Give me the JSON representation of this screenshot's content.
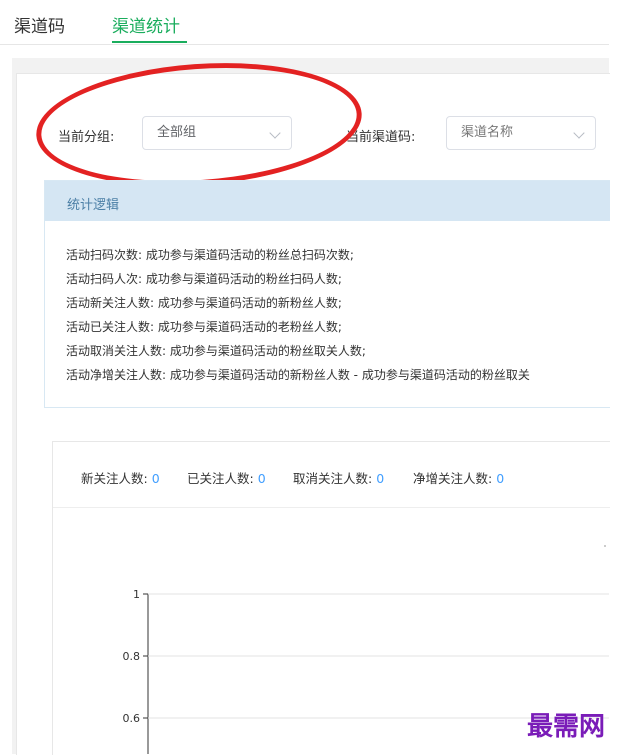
{
  "tabs": [
    {
      "label": "渠道码"
    },
    {
      "label": "渠道统计"
    }
  ],
  "filters": {
    "group_label": "当前分组:",
    "group_value": "全部组",
    "channel_label": "当前渠道码:",
    "channel_placeholder": "渠道名称"
  },
  "logic": {
    "title": "统计逻辑",
    "lines": [
      "活动扫码次数: 成功参与渠道码活动的粉丝总扫码次数;",
      "活动扫码人次: 成功参与渠道码活动的粉丝扫码人数;",
      "活动新关注人数: 成功参与渠道码活动的新粉丝人数;",
      "活动已关注人数: 成功参与渠道码活动的老粉丝人数;",
      "活动取消关注人数: 成功参与渠道码活动的粉丝取关人数;",
      "活动净增关注人数: 成功参与渠道码活动的新粉丝人数 - 成功参与渠道码活动的粉丝取关"
    ]
  },
  "stats": [
    {
      "label": "新关注人数:",
      "value": "0"
    },
    {
      "label": "已关注人数:",
      "value": "0"
    },
    {
      "label": "取消关注人数:",
      "value": "0"
    },
    {
      "label": "净增关注人数:",
      "value": "0"
    }
  ],
  "chart_data": {
    "type": "line",
    "y_ticks": [
      "1",
      "0.8",
      "0.6"
    ],
    "ylim": [
      0,
      1
    ],
    "series": []
  },
  "watermark": "最需网",
  "colors": {
    "accent": "#1aad5d",
    "value": "#409eff",
    "annotation": "#e32222"
  }
}
